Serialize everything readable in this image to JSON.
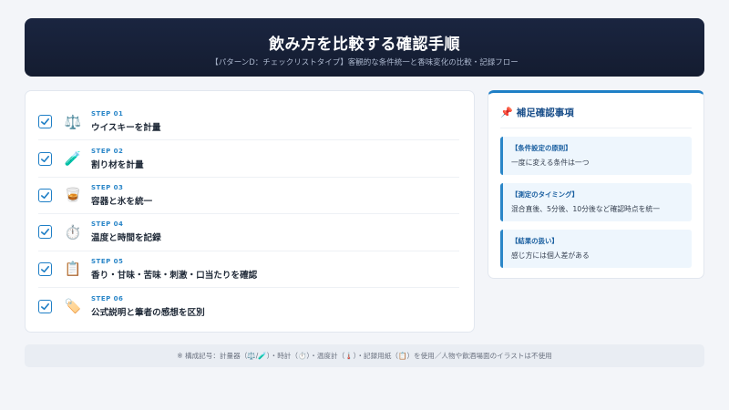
{
  "header": {
    "title": "飲み方を比較する確認手順",
    "subtitle": "【パターンD：チェックリストタイプ】客観的な条件統一と香味変化の比較・記録フロー"
  },
  "steps": [
    {
      "no": "STEP 01",
      "label": "ウイスキーを計量",
      "icon": "⚖️",
      "icon_name": "scale-icon"
    },
    {
      "no": "STEP 02",
      "label": "割り材を計量",
      "icon": "🧪",
      "icon_name": "test-tube-icon"
    },
    {
      "no": "STEP 03",
      "label": "容器と氷を統一",
      "icon": "🥃",
      "icon_name": "tumbler-glass-icon"
    },
    {
      "no": "STEP 04",
      "label": "温度と時間を記録",
      "icon": "⏱️",
      "icon_name": "stopwatch-icon"
    },
    {
      "no": "STEP 05",
      "label": "香り・甘味・苦味・刺激・口当たりを確認",
      "icon": "📋",
      "icon_name": "clipboard-icon"
    },
    {
      "no": "STEP 06",
      "label": "公式説明と筆者の感想を区別",
      "icon": "🏷️",
      "icon_name": "label-tag-icon"
    }
  ],
  "notes": {
    "title": "補足確認事項",
    "items": [
      {
        "head": "【条件設定の原則】",
        "body": "一度に変える条件は一つ"
      },
      {
        "head": "【測定のタイミング】",
        "body": "混合直後、5分後、10分後など確認時点を統一"
      },
      {
        "head": "【結果の扱い】",
        "body": "感じ方には個人差がある"
      }
    ]
  },
  "footer": {
    "text": "※ 構成記号：計量器（⚖️/🧪）・時計（⏱️）・温度計（🌡️）・記録用紙（📋）を使用／人物や飲酒場面のイラストは不使用"
  },
  "colors": {
    "header_bg": "#141c30",
    "accent": "#1f7fc6",
    "note_bg": "#eef6fd"
  }
}
